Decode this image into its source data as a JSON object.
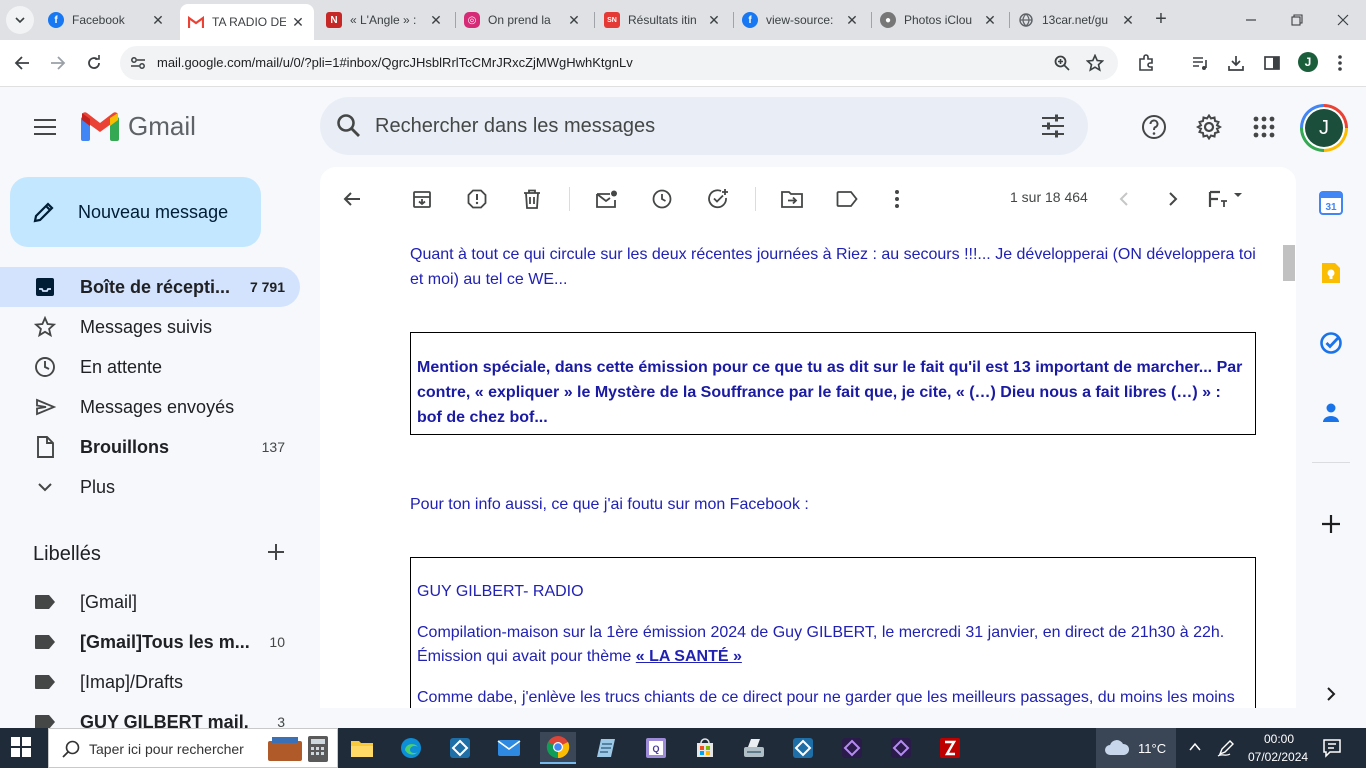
{
  "browser": {
    "tabs": [
      {
        "title": "Facebook",
        "favicon": "facebook-icon",
        "color": "#1877f2"
      },
      {
        "title": "TA RADIO DE",
        "favicon": "gmail-icon",
        "color": "#ea4335"
      },
      {
        "title": "« L'Angle » :",
        "favicon": "news-icon",
        "color": "#c62828"
      },
      {
        "title": "On prend la",
        "favicon": "instagram-icon",
        "color": "#d62976"
      },
      {
        "title": "Résultats itin",
        "favicon": "sncf-icon",
        "color": "#e53935"
      },
      {
        "title": "view-source:",
        "favicon": "facebook-icon",
        "color": "#1877f2"
      },
      {
        "title": "Photos iClou",
        "favicon": "apple-icon",
        "color": "#555555"
      },
      {
        "title": "13car.net/gu",
        "favicon": "globe-icon",
        "color": "#5f6368"
      }
    ],
    "url": "mail.google.com/mail/u/0/?pli=1#inbox/QgrcJHsblRrlTcCMrJRxcZjMWgHwhKtgnLv",
    "profile_initial": "J"
  },
  "gmail": {
    "logo_text": "Gmail",
    "search_placeholder": "Rechercher dans les messages",
    "avatar_initial": "J",
    "compose_label": "Nouveau message",
    "nav": [
      {
        "label": "Boîte de récepti...",
        "count": "7 791",
        "icon": "inbox-icon",
        "bold": true,
        "active": true
      },
      {
        "label": "Messages suivis",
        "count": "",
        "icon": "star-icon",
        "bold": false
      },
      {
        "label": "En attente",
        "count": "",
        "icon": "clock-icon",
        "bold": false
      },
      {
        "label": "Messages envoyés",
        "count": "",
        "icon": "send-icon",
        "bold": false
      },
      {
        "label": "Brouillons",
        "count": "137",
        "icon": "draft-icon",
        "bold": true
      },
      {
        "label": "Plus",
        "count": "",
        "icon": "chevron-down-icon",
        "bold": false
      }
    ],
    "labels_title": "Libellés",
    "labels": [
      {
        "label": "[Gmail]",
        "count": "",
        "bold": false
      },
      {
        "label": "[Gmail]Tous les m...",
        "count": "10",
        "bold": true
      },
      {
        "label": "[Imap]/Drafts",
        "count": "",
        "bold": false
      },
      {
        "label": "GUY GILBERT mail...",
        "count": "3",
        "bold": true
      }
    ],
    "pager": "1 sur 18 464"
  },
  "message": {
    "para1": "Quant à tout ce qui circule sur les deux récentes journées à Riez : au secours !!!... Je développerai (ON développera toi et moi) au tel ce WE...",
    "box1": "Mention spéciale, dans cette émission pour ce que tu as dit sur le fait qu'il est 13 important de marcher... Par contre, « expliquer » le Mystère de la Souffrance par le fait que, je cite, « (…) Dieu nous a fait libres (…) » : bof de chez bof...",
    "para2": "Pour ton info aussi, ce que j'ai foutu sur mon Facebook :",
    "box2_title": "GUY GILBERT- RADIO",
    "box2_line1": "Compilation-maison sur la 1ère émission 2024 de Guy GILBERT, le mercredi 31 janvier, en direct de 21h30 à 22h.",
    "box2_line2_prefix": "Émission qui avait pour thème ",
    "box2_line2_link": "« LA SANTÉ »",
    "box2_line3": "Comme dabe, j'enlève les trucs chiants de ce direct pour ne garder que les meilleurs passages, du moins les moins"
  },
  "taskbar": {
    "search_label": "Taper ici pour rechercher",
    "weather": "11°C",
    "time": "00:00",
    "date": "07/02/2024"
  }
}
